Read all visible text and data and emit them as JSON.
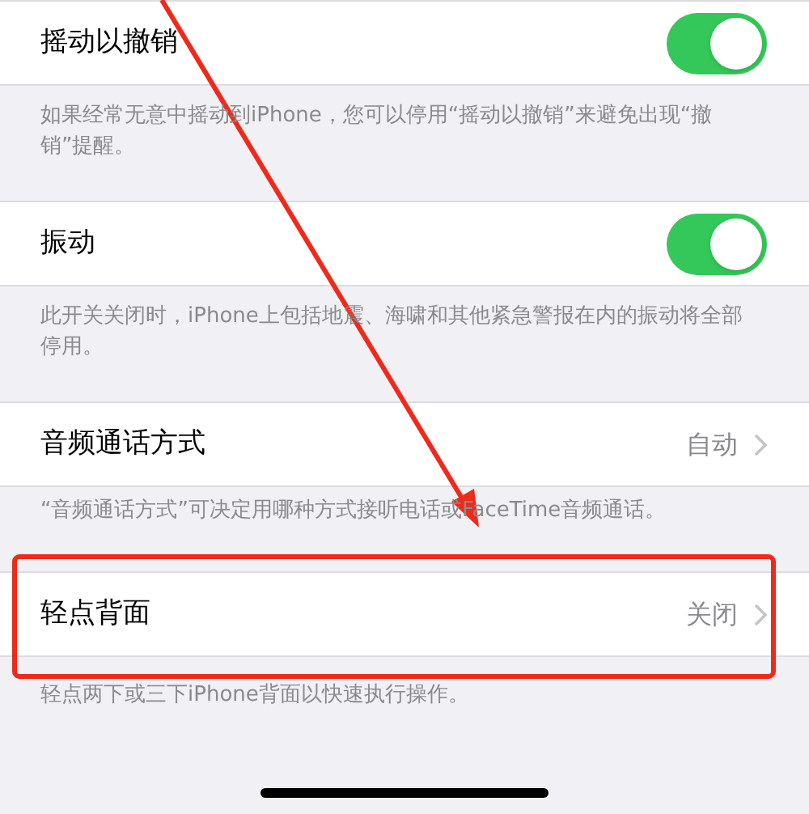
{
  "sections": [
    {
      "kind": "toggle",
      "label": "摇动以撤销",
      "on": true,
      "footer": "如果经常无意中摇动到iPhone，您可以停用“摇动以撤销”来避免出现“撤销”提醒。"
    },
    {
      "kind": "toggle",
      "label": "振动",
      "on": true,
      "footer": "此开关关闭时，iPhone上包括地震、海啸和其他紧急警报在内的振动将全部停用。"
    },
    {
      "kind": "disclosure",
      "label": "音频通话方式",
      "value": "自动",
      "footer": "“音频通话方式”可决定用哪种方式接听电话或FaceTime音频通话。"
    },
    {
      "kind": "disclosure",
      "label": "轻点背面",
      "value": "关闭",
      "footer": "轻点两下或三下iPhone背面以快速执行操作。"
    }
  ]
}
